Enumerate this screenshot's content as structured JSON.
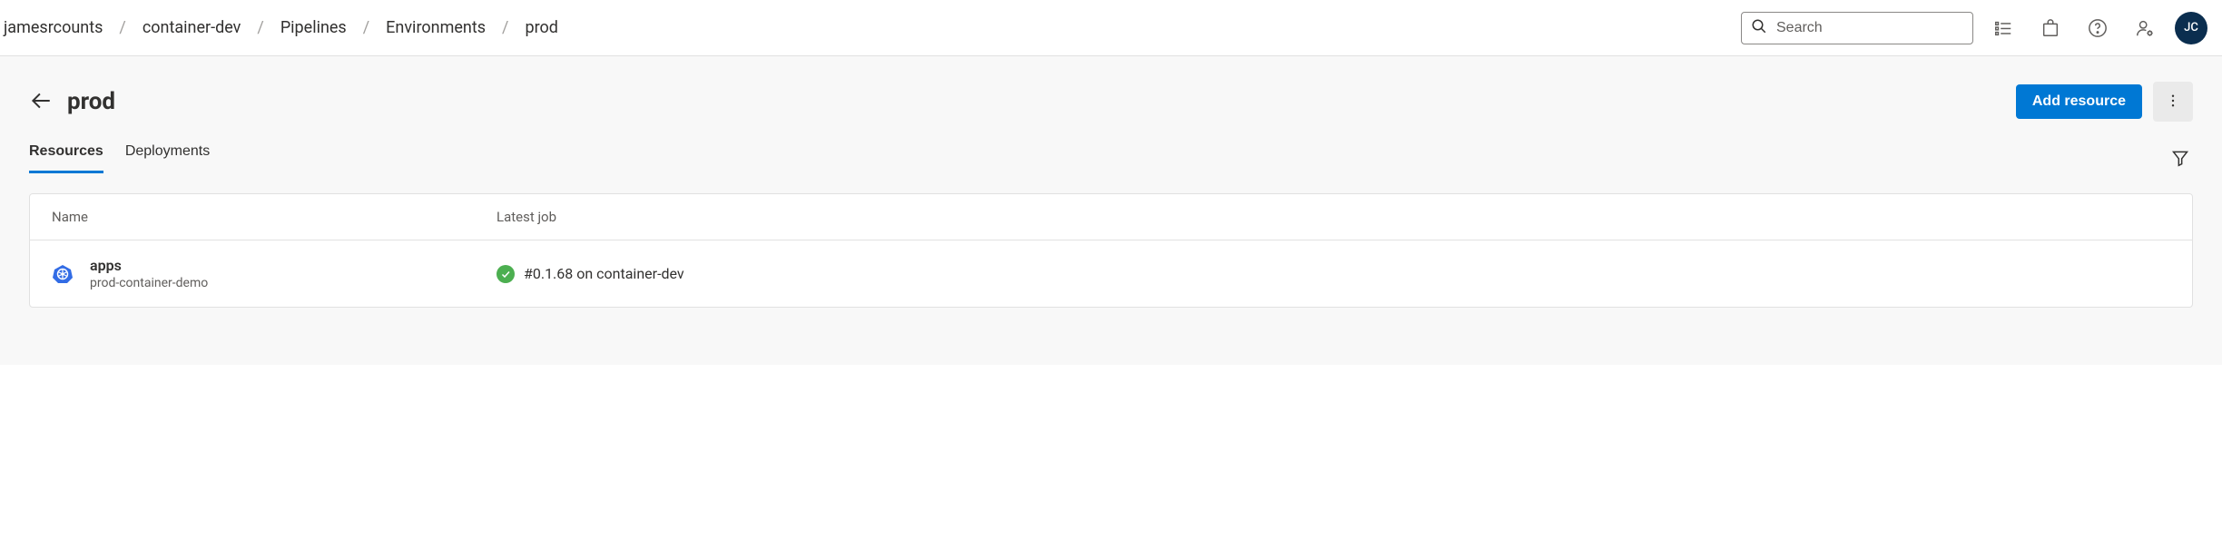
{
  "breadcrumb": {
    "items": [
      {
        "label": "jamesrcounts"
      },
      {
        "label": "container-dev"
      },
      {
        "label": "Pipelines"
      },
      {
        "label": "Environments"
      },
      {
        "label": "prod"
      }
    ]
  },
  "search": {
    "placeholder": "Search"
  },
  "avatar": {
    "initials": "JC"
  },
  "page": {
    "title": "prod",
    "add_resource_label": "Add resource"
  },
  "tabs": [
    {
      "label": "Resources",
      "active": true
    },
    {
      "label": "Deployments",
      "active": false
    }
  ],
  "table": {
    "columns": {
      "name": "Name",
      "latest_job": "Latest job"
    },
    "rows": [
      {
        "name": "apps",
        "subtitle": "prod-container-demo",
        "job": "#0.1.68 on container-dev",
        "status": "success"
      }
    ]
  }
}
